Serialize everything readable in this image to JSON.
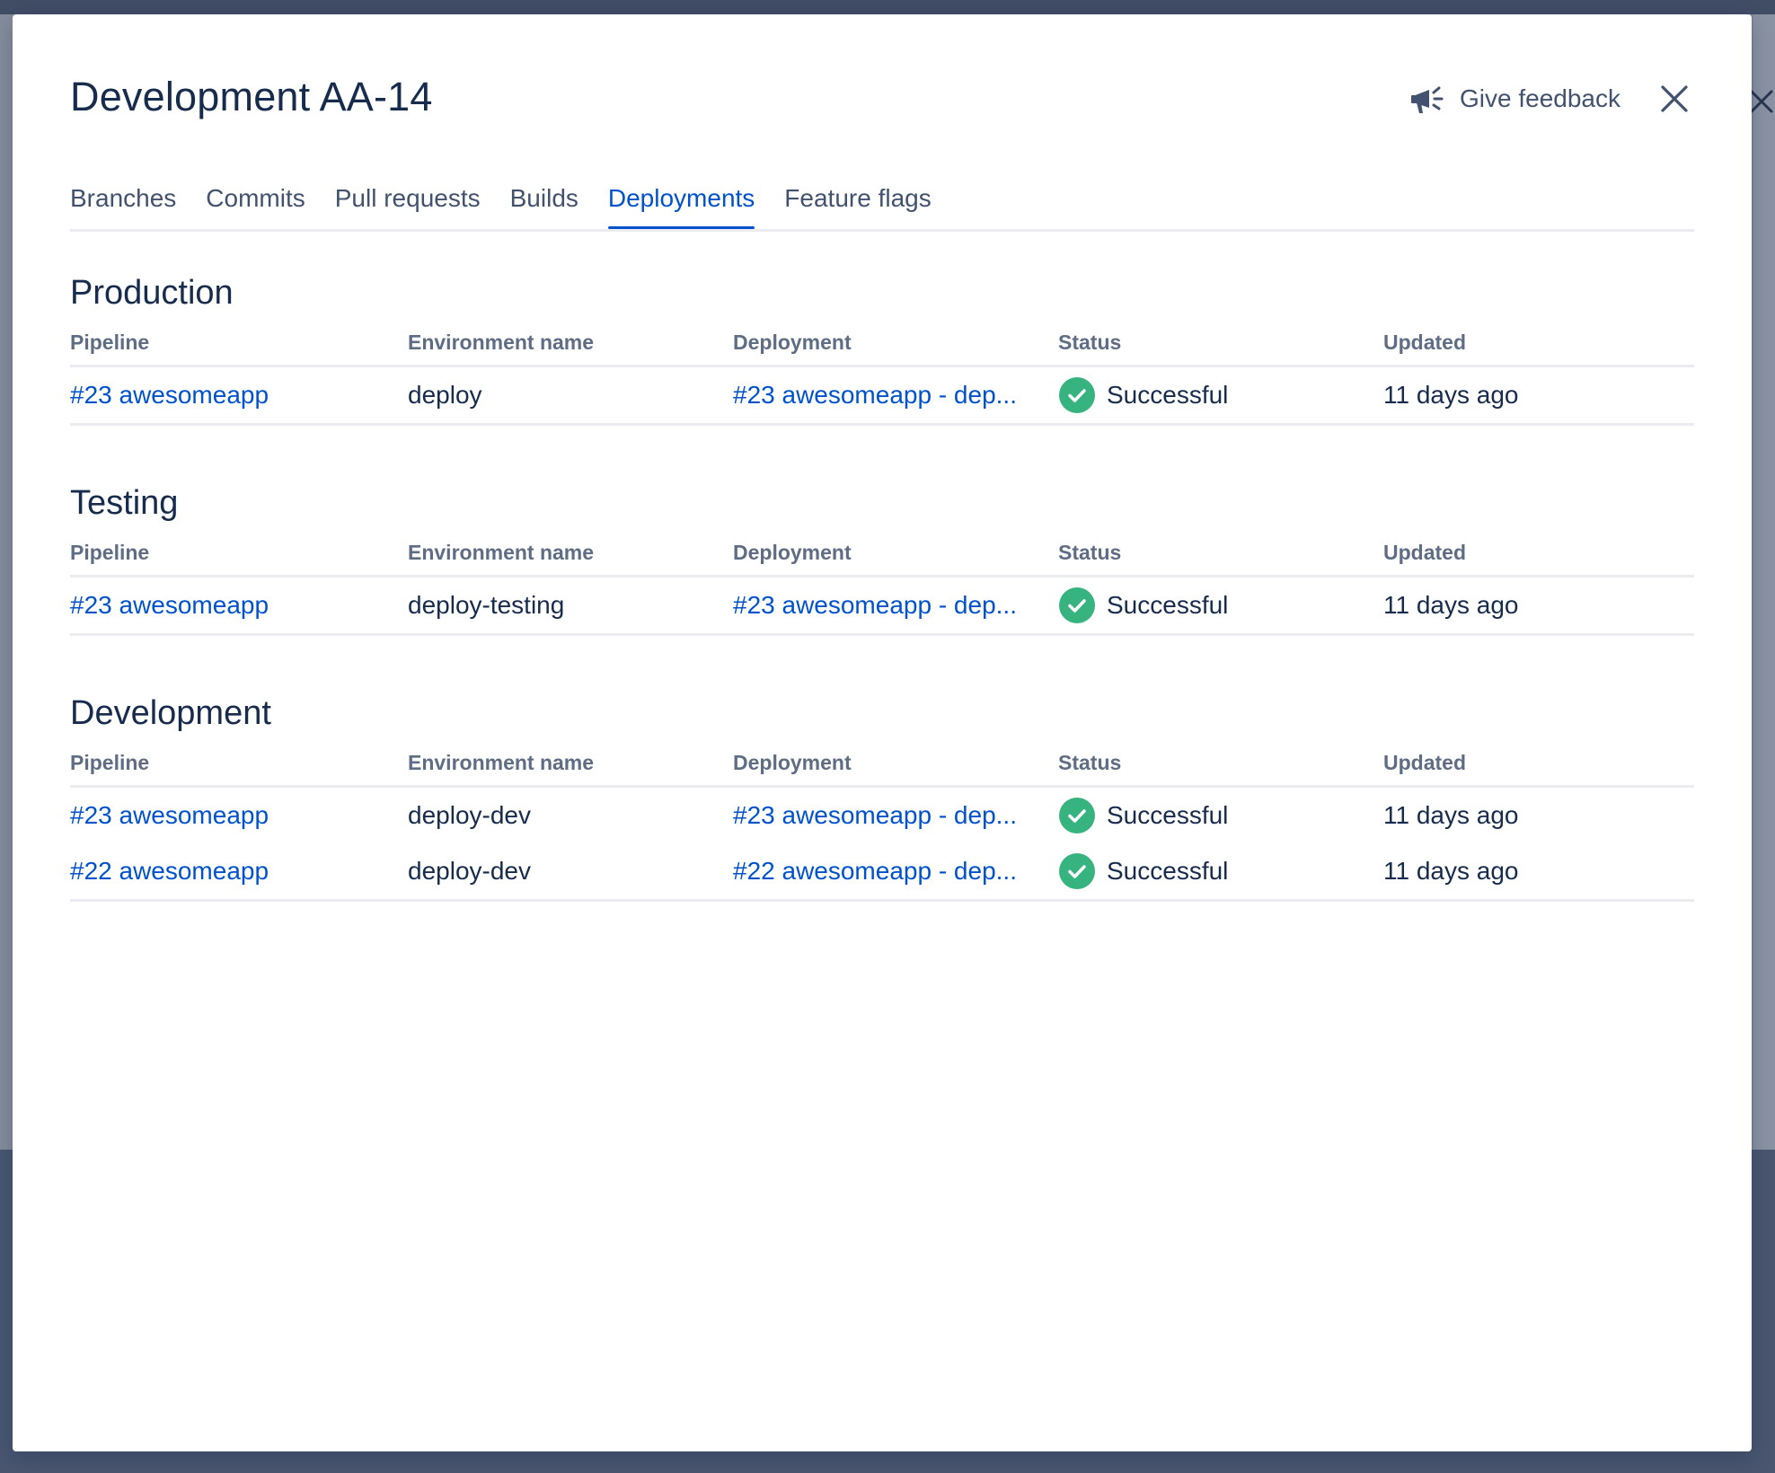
{
  "modal": {
    "title": "Development AA-14",
    "feedback_label": "Give feedback"
  },
  "tabs": [
    {
      "label": "Branches",
      "active": false
    },
    {
      "label": "Commits",
      "active": false
    },
    {
      "label": "Pull requests",
      "active": false
    },
    {
      "label": "Builds",
      "active": false
    },
    {
      "label": "Deployments",
      "active": true
    },
    {
      "label": "Feature flags",
      "active": false
    }
  ],
  "columns": {
    "pipeline": "Pipeline",
    "environment": "Environment name",
    "deployment": "Deployment",
    "status": "Status",
    "updated": "Updated"
  },
  "sections": [
    {
      "title": "Production",
      "rows": [
        {
          "pipeline": "#23 awesomeapp",
          "environment": "deploy",
          "deployment": "#23 awesomeapp - dep...",
          "status": "Successful",
          "updated": "11 days ago"
        }
      ]
    },
    {
      "title": "Testing",
      "rows": [
        {
          "pipeline": "#23 awesomeapp",
          "environment": "deploy-testing",
          "deployment": "#23 awesomeapp - dep...",
          "status": "Successful",
          "updated": "11 days ago"
        }
      ]
    },
    {
      "title": "Development",
      "rows": [
        {
          "pipeline": "#23 awesomeapp",
          "environment": "deploy-dev",
          "deployment": "#23 awesomeapp - dep...",
          "status": "Successful",
          "updated": "11 days ago"
        },
        {
          "pipeline": "#22 awesomeapp",
          "environment": "deploy-dev",
          "deployment": "#22 awesomeapp - dep...",
          "status": "Successful",
          "updated": "11 days ago"
        }
      ]
    }
  ],
  "colors": {
    "link": "#0052cc",
    "title": "#172b4d",
    "success": "#36b37e",
    "muted": "#5e6c84"
  }
}
